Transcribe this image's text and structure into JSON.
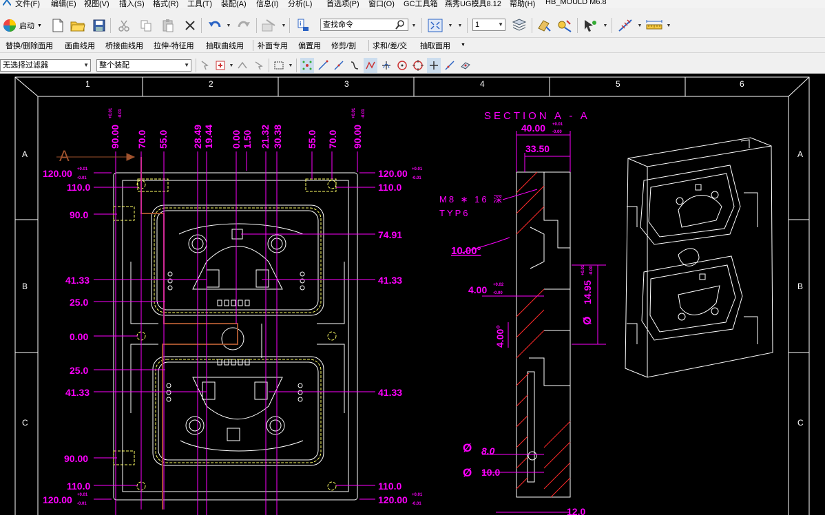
{
  "menu": {
    "items": [
      "文件(F)",
      "编辑(E)",
      "视图(V)",
      "插入(S)",
      "格式(R)",
      "工具(T)",
      "装配(A)",
      "信息(I)",
      "分析(L)",
      "首选项(P)",
      "窗口(O)",
      "GC工具箱",
      "燕秀UG模具8.12",
      "帮助(H)",
      "HB_MOULD M6.8"
    ]
  },
  "toolbar1": {
    "start_label": "启动",
    "search_placeholder": "查找命令",
    "layer_value": "1"
  },
  "toolbar2": {
    "items": [
      "替换/删除面用",
      "画曲线用",
      "桥接曲线用",
      "拉伸-特征用",
      "抽取曲线用",
      "补面专用",
      "偏置用",
      "修剪/割",
      "求和/差/交",
      "抽取面用"
    ]
  },
  "toolbar3": {
    "filter_value": "无选择过滤器",
    "scope_value": "整个装配"
  },
  "border": {
    "columns": [
      "1",
      "2",
      "3",
      "4",
      "5",
      "6"
    ],
    "rows": [
      "A",
      "B",
      "C"
    ]
  },
  "section": {
    "title": "SECTION  A - A",
    "cut_label": "A",
    "thread_note_1": "M8 ∗ 16 深",
    "thread_note_2": "TYP6",
    "dims": {
      "d40": "40.00",
      "d40_tol_up": "+0.01",
      "d40_tol_dn": "-0.00",
      "d33": "33.50",
      "angle": "10.00°",
      "d4a": "4.00",
      "d4a_tol_up": "+0.02",
      "d4a_tol_dn": "-0.00",
      "d4b": "4.00°",
      "d1495": "14.95",
      "d1495_tol_up": "+0.01",
      "d1495_tol_dn": "-0.00",
      "phi8": "8.0",
      "phi10": "10.0",
      "d12": "12.0",
      "phi": "Ø"
    }
  },
  "plan": {
    "top_dims": [
      "90.00",
      "70.0",
      "55.0",
      "28.49",
      "19.44",
      "0.00",
      "1.50",
      "21.32",
      "30.38",
      "55.0",
      "70.0",
      "90.00"
    ],
    "tol_up": "+0.01",
    "tol_dn": "-0.01",
    "left_dims": [
      "120.00",
      "110.0",
      "90.0",
      "41.33",
      "25.0",
      "0.00",
      "25.0",
      "41.33",
      "90.00",
      "110.0",
      "120.00"
    ],
    "right_dims": [
      "120.00",
      "110.0",
      "74.91",
      "41.33",
      "41.33",
      "110.0",
      "120.00"
    ]
  },
  "colors": {
    "annotation": "#ff00ff",
    "geometry": "#ffffff",
    "hidden": "#ffff66",
    "section_hatch": "#ff2a2a",
    "path": "#a0522d"
  }
}
